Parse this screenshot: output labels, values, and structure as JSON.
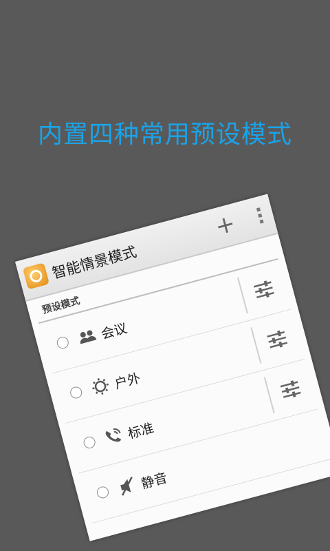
{
  "headline": "内置四种常用预设模式",
  "app": {
    "title": "智能情景模式",
    "add_glyph": "+"
  },
  "section": {
    "label": "预设模式"
  },
  "profiles": [
    {
      "label": "会议",
      "icon": "people-icon",
      "selected": false
    },
    {
      "label": "户外",
      "icon": "sun-icon",
      "selected": false
    },
    {
      "label": "标准",
      "icon": "phone-ring-icon",
      "selected": false
    },
    {
      "label": "静音",
      "icon": "mute-icon",
      "selected": false
    }
  ],
  "colors": {
    "background": "#5a5959",
    "headline": "#1aa3e8",
    "card": "#fbfbfb"
  }
}
